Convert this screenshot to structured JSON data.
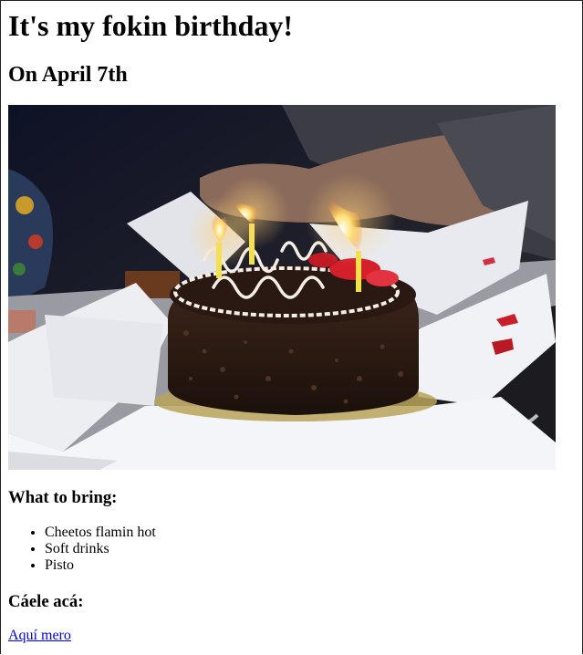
{
  "page": {
    "title": "It's my fokin birthday!",
    "subtitle": "On April 7th"
  },
  "photo": {
    "alt": "birthday cake with lit candles",
    "colors": {
      "background": "#1a1a22",
      "box": "#eceef2",
      "cake": "#2a1a14",
      "flame": "#ffcc44",
      "candle": "#f2e24a",
      "frosting": "#f5eee6",
      "strawberry": "#d4202a"
    }
  },
  "bring": {
    "heading": "What to bring:",
    "items": [
      "Cheetos flamin hot",
      "Soft drinks",
      "Pisto"
    ]
  },
  "click": {
    "heading": "Cáele acá:",
    "link_text": "Aquí mero",
    "link_color": "#0000ee"
  }
}
